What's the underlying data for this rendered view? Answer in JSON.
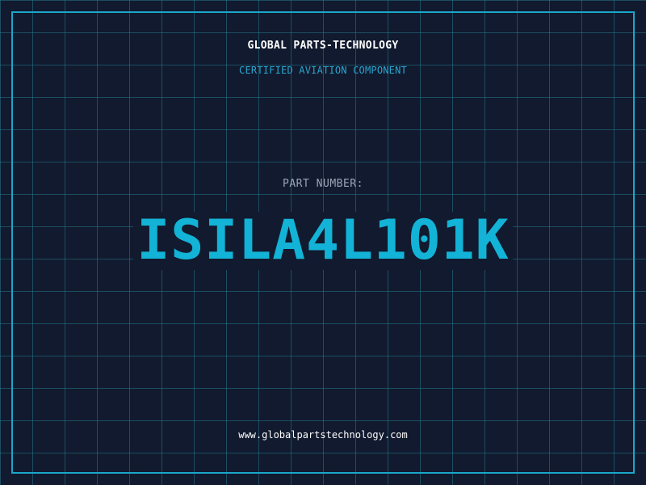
{
  "header": {
    "company": "GLOBAL PARTS-TECHNOLOGY",
    "tagline": "CERTIFIED AVIATION COMPONENT"
  },
  "part": {
    "label": "PART NUMBER:",
    "number": "ISILA4L101K"
  },
  "footer": {
    "website": "www.globalpartstechnology.com"
  },
  "colors": {
    "background": "#111a2e",
    "grid": "#26768c",
    "frame": "#1aa7c9",
    "accent": "#12b3d6",
    "tagline": "#2aa5d0",
    "label": "#9aa6b8",
    "text": "#ffffff"
  }
}
